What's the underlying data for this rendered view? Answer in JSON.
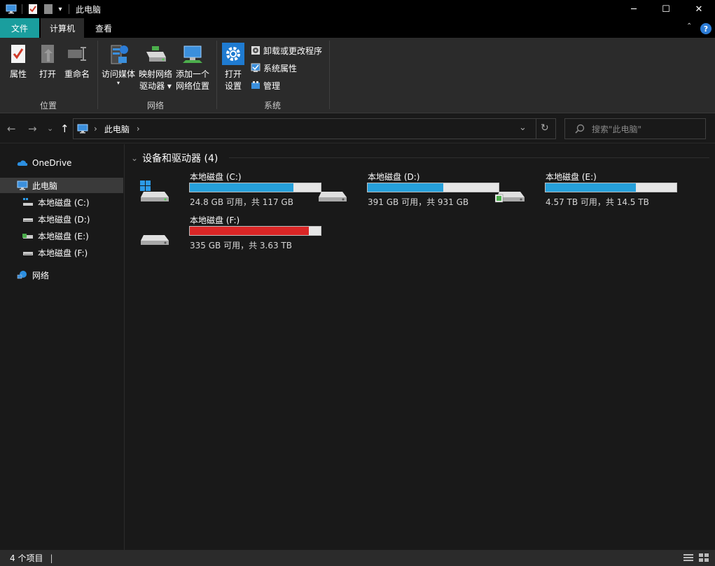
{
  "window": {
    "title": "此电脑",
    "minimize_glyph": "─",
    "maximize_glyph": "☐",
    "close_glyph": "✕",
    "quick_access_dropdown": "▾"
  },
  "ribbon_tabs": [
    {
      "label": "文件"
    },
    {
      "label": "计算机"
    },
    {
      "label": "查看"
    }
  ],
  "ribbon_controls": {
    "collapse_glyph": "⌃",
    "help_glyph": "?"
  },
  "ribbon": {
    "location": {
      "group_label": "位置",
      "properties": "属性",
      "open": "打开",
      "rename": "重命名"
    },
    "network": {
      "group_label": "网络",
      "access_media": "访问媒体",
      "access_media_dropdown": "▾",
      "map_drive_line1": "映射网络",
      "map_drive_line2": "驱动器 ▾",
      "add_location_line1": "添加一个",
      "add_location_line2": "网络位置"
    },
    "system": {
      "group_label": "系统",
      "open_settings_line1": "打开",
      "open_settings_line2": "设置",
      "uninstall": "卸载或更改程序",
      "system_properties": "系统属性",
      "manage": "管理"
    }
  },
  "address_bar": {
    "breadcrumb": "此电脑",
    "separator": "›",
    "trailing_chevron": "›",
    "dropdown_glyph": "⌄",
    "refresh_glyph": "↻"
  },
  "nav_buttons": {
    "back": "←",
    "forward": "→",
    "recent": "⌄",
    "up": "↑"
  },
  "search": {
    "placeholder": "搜索\"此电脑\""
  },
  "sidebar": {
    "onedrive": "OneDrive",
    "this_pc": "此电脑",
    "drives": [
      {
        "label": "本地磁盘 (C:)"
      },
      {
        "label": "本地磁盘 (D:)"
      },
      {
        "label": "本地磁盘 (E:)"
      },
      {
        "label": "本地磁盘 (F:)"
      }
    ],
    "network": "网络"
  },
  "section": {
    "title": "设备和驱动器 (4)",
    "collapse_glyph": "⌄"
  },
  "drives": [
    {
      "name": "本地磁盘 (C:)",
      "free_text": "24.8 GB 可用，共 117 GB",
      "used_fraction": 0.79,
      "icon": "windows-drive-icon",
      "bar_color": "#26a0da"
    },
    {
      "name": "本地磁盘 (D:)",
      "free_text": "391 GB 可用，共 931 GB",
      "used_fraction": 0.58,
      "icon": "drive-icon",
      "bar_color": "#26a0da"
    },
    {
      "name": "本地磁盘 (E:)",
      "free_text": "4.57 TB 可用，共 14.5 TB",
      "used_fraction": 0.69,
      "icon": "drive-badge-icon",
      "bar_color": "#26a0da"
    },
    {
      "name": "本地磁盘 (F:)",
      "free_text": "335 GB 可用，共 3.63 TB",
      "used_fraction": 0.91,
      "icon": "drive-icon",
      "bar_color": "#da2626"
    }
  ],
  "status_bar": {
    "item_count": "4 个项目",
    "separator": "|"
  },
  "colors": {
    "accent": "#1a9e9e",
    "bar_normal": "#26a0da",
    "bar_full": "#da2626"
  }
}
